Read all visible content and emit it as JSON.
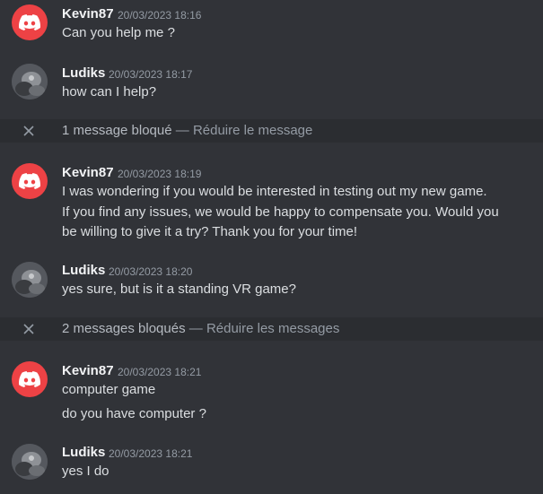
{
  "messages": [
    {
      "username": "Kevin87",
      "timestamp": "20/03/2023 18:16",
      "avatar": "discord-logo-icon",
      "lines": [
        "Can you help me ?"
      ]
    },
    {
      "username": "Ludiks",
      "timestamp": "20/03/2023 18:17",
      "avatar": "user-photo",
      "lines": [
        "how can I help?"
      ]
    },
    {
      "username": "Kevin87",
      "timestamp": "20/03/2023 18:19",
      "avatar": "discord-logo-icon",
      "lines": [
        "I was wondering if you would be interested in testing out my new game.",
        "If you find any issues, we would be happy to compensate you. Would you",
        "be willing to give it a try? Thank you for your time!"
      ]
    },
    {
      "username": "Ludiks",
      "timestamp": "20/03/2023 18:20",
      "avatar": "user-photo",
      "lines": [
        "yes sure, but is it a standing VR game?"
      ]
    },
    {
      "username": "Kevin87",
      "timestamp": "20/03/2023 18:21",
      "avatar": "discord-logo-icon",
      "lines": [
        "computer game",
        "do you have computer ?"
      ]
    },
    {
      "username": "Ludiks",
      "timestamp": "20/03/2023 18:21",
      "avatar": "user-photo",
      "lines": [
        "yes I do"
      ]
    }
  ],
  "blocked": [
    {
      "text": "1 message bloqué",
      "separator": "—",
      "action": "Réduire le message"
    },
    {
      "text": "2 messages bloqués",
      "separator": "—",
      "action": "Réduire les messages"
    }
  ],
  "colors": {
    "background": "#313338",
    "blocked_bar": "#2b2d31",
    "discord_red": "#ed4245"
  }
}
